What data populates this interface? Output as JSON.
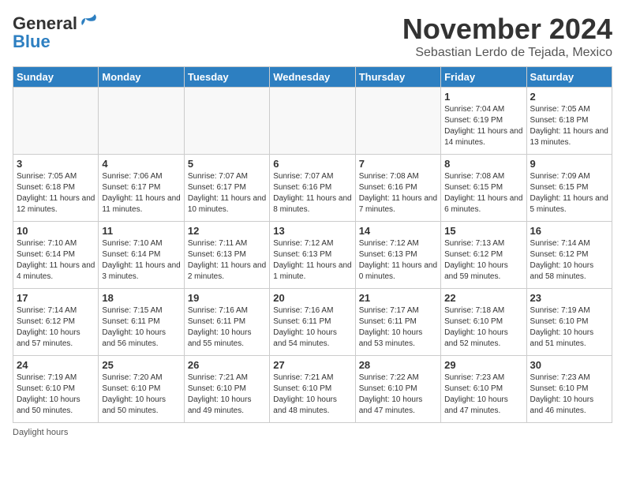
{
  "header": {
    "logo_general": "General",
    "logo_blue": "Blue",
    "title": "November 2024",
    "subtitle": "Sebastian Lerdo de Tejada, Mexico"
  },
  "days_of_week": [
    "Sunday",
    "Monday",
    "Tuesday",
    "Wednesday",
    "Thursday",
    "Friday",
    "Saturday"
  ],
  "weeks": [
    [
      {
        "day": "",
        "info": ""
      },
      {
        "day": "",
        "info": ""
      },
      {
        "day": "",
        "info": ""
      },
      {
        "day": "",
        "info": ""
      },
      {
        "day": "",
        "info": ""
      },
      {
        "day": "1",
        "info": "Sunrise: 7:04 AM\nSunset: 6:19 PM\nDaylight: 11 hours and 14 minutes."
      },
      {
        "day": "2",
        "info": "Sunrise: 7:05 AM\nSunset: 6:18 PM\nDaylight: 11 hours and 13 minutes."
      }
    ],
    [
      {
        "day": "3",
        "info": "Sunrise: 7:05 AM\nSunset: 6:18 PM\nDaylight: 11 hours and 12 minutes."
      },
      {
        "day": "4",
        "info": "Sunrise: 7:06 AM\nSunset: 6:17 PM\nDaylight: 11 hours and 11 minutes."
      },
      {
        "day": "5",
        "info": "Sunrise: 7:07 AM\nSunset: 6:17 PM\nDaylight: 11 hours and 10 minutes."
      },
      {
        "day": "6",
        "info": "Sunrise: 7:07 AM\nSunset: 6:16 PM\nDaylight: 11 hours and 8 minutes."
      },
      {
        "day": "7",
        "info": "Sunrise: 7:08 AM\nSunset: 6:16 PM\nDaylight: 11 hours and 7 minutes."
      },
      {
        "day": "8",
        "info": "Sunrise: 7:08 AM\nSunset: 6:15 PM\nDaylight: 11 hours and 6 minutes."
      },
      {
        "day": "9",
        "info": "Sunrise: 7:09 AM\nSunset: 6:15 PM\nDaylight: 11 hours and 5 minutes."
      }
    ],
    [
      {
        "day": "10",
        "info": "Sunrise: 7:10 AM\nSunset: 6:14 PM\nDaylight: 11 hours and 4 minutes."
      },
      {
        "day": "11",
        "info": "Sunrise: 7:10 AM\nSunset: 6:14 PM\nDaylight: 11 hours and 3 minutes."
      },
      {
        "day": "12",
        "info": "Sunrise: 7:11 AM\nSunset: 6:13 PM\nDaylight: 11 hours and 2 minutes."
      },
      {
        "day": "13",
        "info": "Sunrise: 7:12 AM\nSunset: 6:13 PM\nDaylight: 11 hours and 1 minute."
      },
      {
        "day": "14",
        "info": "Sunrise: 7:12 AM\nSunset: 6:13 PM\nDaylight: 11 hours and 0 minutes."
      },
      {
        "day": "15",
        "info": "Sunrise: 7:13 AM\nSunset: 6:12 PM\nDaylight: 10 hours and 59 minutes."
      },
      {
        "day": "16",
        "info": "Sunrise: 7:14 AM\nSunset: 6:12 PM\nDaylight: 10 hours and 58 minutes."
      }
    ],
    [
      {
        "day": "17",
        "info": "Sunrise: 7:14 AM\nSunset: 6:12 PM\nDaylight: 10 hours and 57 minutes."
      },
      {
        "day": "18",
        "info": "Sunrise: 7:15 AM\nSunset: 6:11 PM\nDaylight: 10 hours and 56 minutes."
      },
      {
        "day": "19",
        "info": "Sunrise: 7:16 AM\nSunset: 6:11 PM\nDaylight: 10 hours and 55 minutes."
      },
      {
        "day": "20",
        "info": "Sunrise: 7:16 AM\nSunset: 6:11 PM\nDaylight: 10 hours and 54 minutes."
      },
      {
        "day": "21",
        "info": "Sunrise: 7:17 AM\nSunset: 6:11 PM\nDaylight: 10 hours and 53 minutes."
      },
      {
        "day": "22",
        "info": "Sunrise: 7:18 AM\nSunset: 6:10 PM\nDaylight: 10 hours and 52 minutes."
      },
      {
        "day": "23",
        "info": "Sunrise: 7:19 AM\nSunset: 6:10 PM\nDaylight: 10 hours and 51 minutes."
      }
    ],
    [
      {
        "day": "24",
        "info": "Sunrise: 7:19 AM\nSunset: 6:10 PM\nDaylight: 10 hours and 50 minutes."
      },
      {
        "day": "25",
        "info": "Sunrise: 7:20 AM\nSunset: 6:10 PM\nDaylight: 10 hours and 50 minutes."
      },
      {
        "day": "26",
        "info": "Sunrise: 7:21 AM\nSunset: 6:10 PM\nDaylight: 10 hours and 49 minutes."
      },
      {
        "day": "27",
        "info": "Sunrise: 7:21 AM\nSunset: 6:10 PM\nDaylight: 10 hours and 48 minutes."
      },
      {
        "day": "28",
        "info": "Sunrise: 7:22 AM\nSunset: 6:10 PM\nDaylight: 10 hours and 47 minutes."
      },
      {
        "day": "29",
        "info": "Sunrise: 7:23 AM\nSunset: 6:10 PM\nDaylight: 10 hours and 47 minutes."
      },
      {
        "day": "30",
        "info": "Sunrise: 7:23 AM\nSunset: 6:10 PM\nDaylight: 10 hours and 46 minutes."
      }
    ]
  ],
  "footer": {
    "daylight_label": "Daylight hours"
  }
}
